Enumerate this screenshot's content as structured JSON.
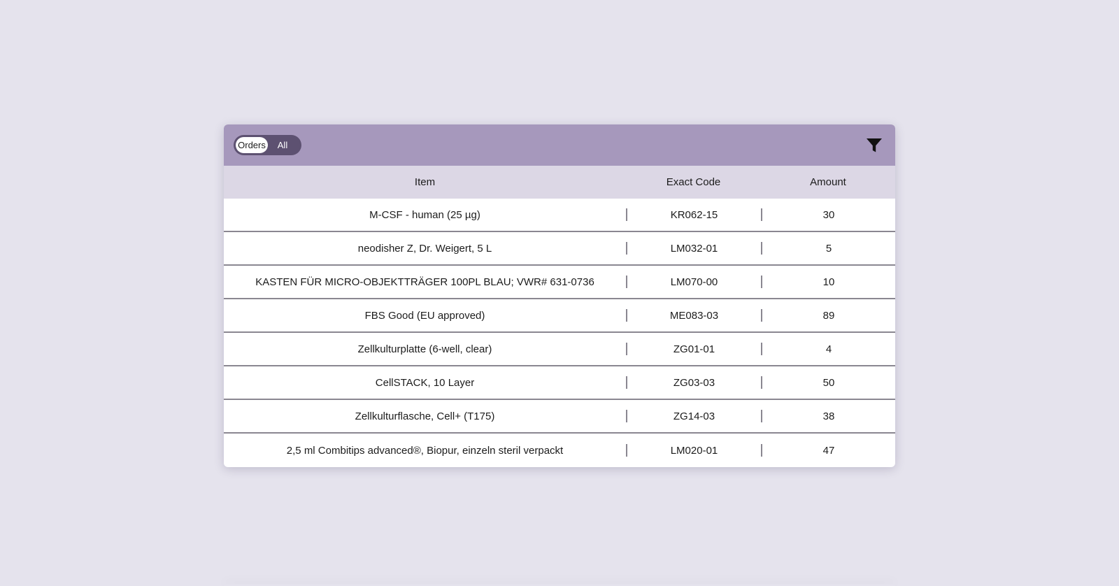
{
  "toolbar": {
    "toggle": {
      "active_label": "Orders",
      "inactive_label": "All"
    },
    "filter_icon": "filter-funnel-icon"
  },
  "table": {
    "columns": [
      "Item",
      "Exact Code",
      "Amount"
    ],
    "rows": [
      {
        "item": "M-CSF - human (25 µg)",
        "code": "KR062-15",
        "amount": "30"
      },
      {
        "item": "neodisher Z, Dr. Weigert, 5 L",
        "code": "LM032-01",
        "amount": "5"
      },
      {
        "item": "KASTEN FÜR MICRO-OBJEKTTRÄGER 100PL BLAU; VWR# 631-0736",
        "code": "LM070-00",
        "amount": "10"
      },
      {
        "item": "FBS Good (EU approved)",
        "code": "ME083-03",
        "amount": "89"
      },
      {
        "item": "Zellkulturplatte (6-well, clear)",
        "code": "ZG01-01",
        "amount": "4"
      },
      {
        "item": "CellSTACK, 10 Layer",
        "code": "ZG03-03",
        "amount": "50"
      },
      {
        "item": "Zellkulturflasche, Cell+ (T175)",
        "code": "ZG14-03",
        "amount": "38"
      },
      {
        "item": "2,5 ml Combitips advanced®, Biopur, einzeln steril verpackt",
        "code": "LM020-01",
        "amount": "47"
      }
    ]
  },
  "colors": {
    "background": "#e5e3ed",
    "toolbar": "#a698bc",
    "header_row": "#dcd7e5",
    "toggle_track": "#5d5171"
  }
}
